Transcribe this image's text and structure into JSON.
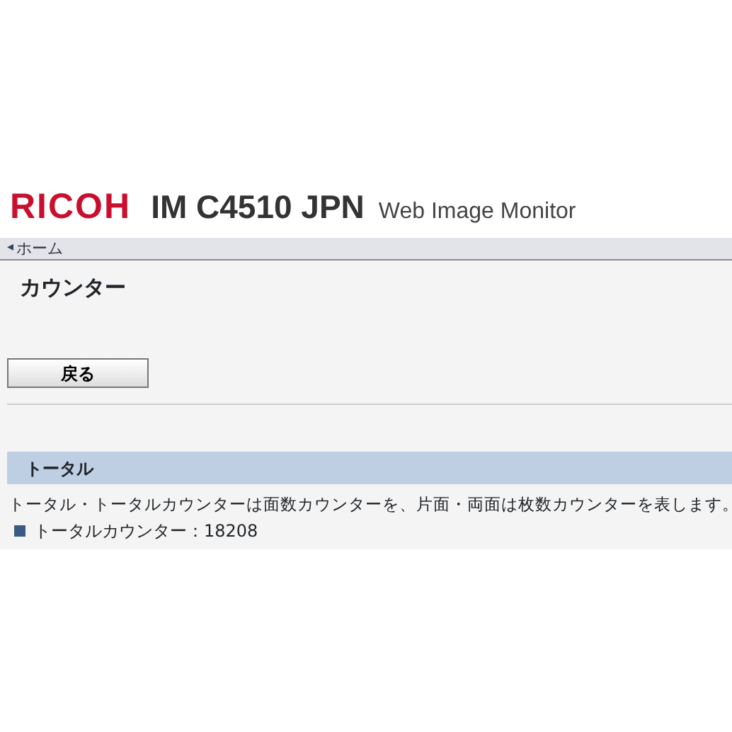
{
  "header": {
    "brand": "RICOH",
    "model": "IM C4510 JPN",
    "product": "Web Image Monitor"
  },
  "breadcrumb": {
    "icon": "◂",
    "label": "ホーム"
  },
  "page_title": "カウンター",
  "back_button": "戻る",
  "section": {
    "title": "トータル",
    "description": "トータル・トータルカウンターは面数カウンターを、片面・両面は枚数カウンターを表します。",
    "items": [
      {
        "label": "トータルカウンター：18208"
      }
    ]
  }
}
